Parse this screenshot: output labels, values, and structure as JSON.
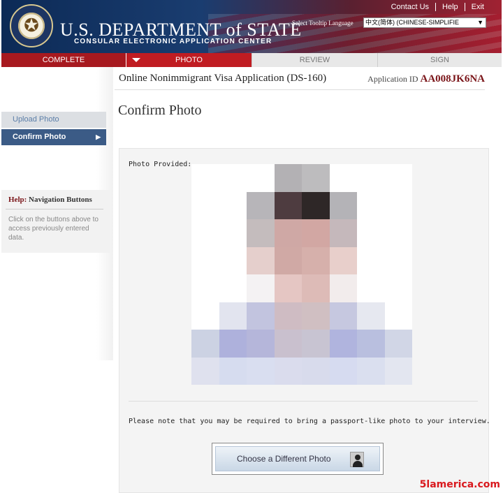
{
  "header": {
    "title_main": "U.S. DEPARTMENT of STATE",
    "title_sub": "CONSULAR ELECTRONIC APPLICATION CENTER",
    "top_links": [
      "Contact Us",
      "Help",
      "Exit"
    ],
    "lang_label": "Select Tooltip Language",
    "lang_value": "中文(简体)  (CHINESE-SIMPLIFIE",
    "seal_icon": "state-department-seal"
  },
  "tabs": [
    "COMPLETE",
    "PHOTO",
    "REVIEW",
    "SIGN"
  ],
  "application": {
    "title": "Online Nonimmigrant Visa Application (DS-160)",
    "id_label": "Application ID",
    "id_value": "AA008JK6NA"
  },
  "sidebar": {
    "items": [
      {
        "label": "Upload Photo"
      },
      {
        "label": "Confirm Photo"
      }
    ],
    "help_title_prefix": "Help:",
    "help_title": "Navigation Buttons",
    "help_text": "Click on the buttons above to access previously entered data."
  },
  "main": {
    "page_title": "Confirm Photo",
    "photo_label": "Photo Provided:",
    "note": "Please note that you may be required to bring a passport-like photo to your interview.",
    "button_label": "Choose a Different Photo"
  },
  "watermark": "5lamerica.com",
  "colors": {
    "accent_red": "#c01c22",
    "nav_blue": "#3b5b86",
    "id_red": "#7a1418"
  },
  "mosaic": [
    [
      "#ffffff",
      "#ffffff",
      "#ffffff",
      "#b3b1b4",
      "#bdbcbe",
      "#ffffff",
      "#ffffff",
      "#ffffff"
    ],
    [
      "#ffffff",
      "#ffffff",
      "#b7b5b9",
      "#4e3c40",
      "#2e2727",
      "#b4b3b7",
      "#ffffff",
      "#ffffff"
    ],
    [
      "#ffffff",
      "#ffffff",
      "#c4bcbd",
      "#cfa8a5",
      "#d2a7a3",
      "#c5b8bb",
      "#ffffff",
      "#ffffff"
    ],
    [
      "#ffffff",
      "#ffffff",
      "#e5cfcc",
      "#d0a9a5",
      "#d6b0ab",
      "#e8cfcb",
      "#ffffff",
      "#ffffff"
    ],
    [
      "#ffffff",
      "#ffffff",
      "#f4f2f3",
      "#e5c6c3",
      "#ddbbb7",
      "#f2ecec",
      "#ffffff",
      "#ffffff"
    ],
    [
      "#ffffff",
      "#e2e4ef",
      "#c2c4df",
      "#cfbcc3",
      "#d0bfc2",
      "#c6c8e0",
      "#e6e8f0",
      "#ffffff"
    ],
    [
      "#ccd2e3",
      "#aeb1dc",
      "#b5b6da",
      "#c9c0ce",
      "#c8c4d2",
      "#b0b4de",
      "#b9bfdf",
      "#d1d6e6"
    ],
    [
      "#dfe1ee",
      "#d6dcef",
      "#d9def0",
      "#dadced",
      "#d8dbec",
      "#d6dbf0",
      "#dadfef",
      "#e3e6f0"
    ]
  ]
}
